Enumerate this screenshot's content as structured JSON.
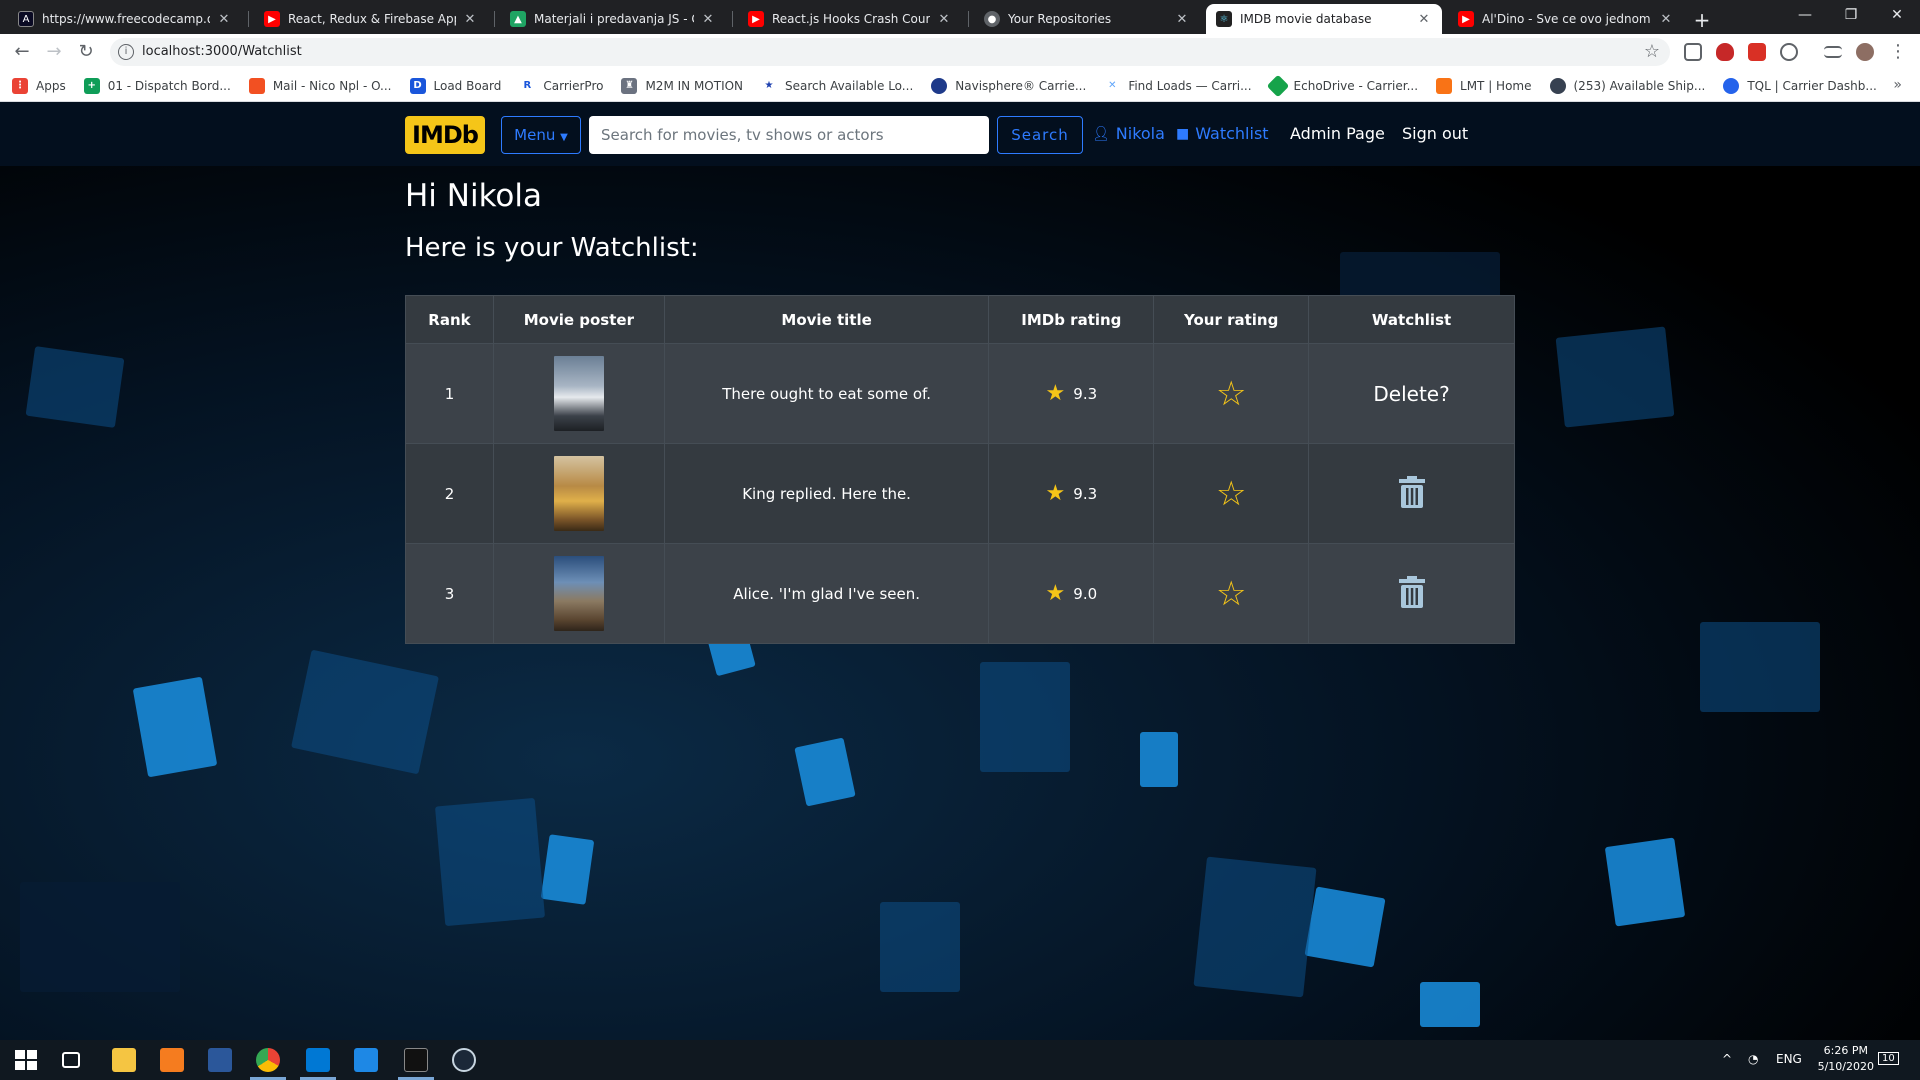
{
  "browser": {
    "tabs": [
      {
        "title": "https://www.freecodecamp.org/l",
        "favicon_color": "#0a0a23",
        "active": false
      },
      {
        "title": "React, Redux & Firebase App Tut",
        "favicon_color": "#ff0000",
        "active": false
      },
      {
        "title": "Materjali i predavanja JS - Googl",
        "favicon_color": "#1fa463",
        "active": false
      },
      {
        "title": "React.js Hooks Crash Course - Yo",
        "favicon_color": "#ff0000",
        "active": false
      },
      {
        "title": "Your Repositories",
        "favicon_color": "#5f6368",
        "active": false
      },
      {
        "title": "IMDB movie database",
        "favicon_color": "#61dafb",
        "active": true
      },
      {
        "title": "Al'Dino - Sve ce ovo jednom",
        "favicon_color": "#ff0000",
        "active": false
      }
    ],
    "url": "localhost:3000/Watchlist",
    "bookmarks": [
      {
        "label": "Apps",
        "color": "#ea4335"
      },
      {
        "label": "01 - Dispatch Bord...",
        "color": "#0f9d58"
      },
      {
        "label": "Mail - Nico Npl - O...",
        "color": "#f25022"
      },
      {
        "label": "Load Board",
        "color": "#1a56db"
      },
      {
        "label": "CarrierPro",
        "color": "#1a56db"
      },
      {
        "label": "M2M IN MOTION",
        "color": "#6b7280"
      },
      {
        "label": "Search Available Lo...",
        "color": "#1e40af"
      },
      {
        "label": "Navisphere® Carrie...",
        "color": "#1e3a8a"
      },
      {
        "label": "Find Loads — Carri...",
        "color": "#60a5fa"
      },
      {
        "label": "EchoDrive - Carrier...",
        "color": "#16a34a"
      },
      {
        "label": "LMT | Home",
        "color": "#f97316"
      },
      {
        "label": "(253) Available Ship...",
        "color": "#374151"
      },
      {
        "label": "TQL | Carrier Dashb...",
        "color": "#2563eb"
      }
    ]
  },
  "site": {
    "logo": "IMDb",
    "menu_label": "Menu",
    "search_placeholder": "Search for movies, tv shows or actors",
    "search_button": "Search",
    "user_link": "Nikola",
    "watchlist_link": "Watchlist",
    "admin_link": "Admin Page",
    "signout_link": "Sign out"
  },
  "page": {
    "greeting": "Hi Nikola",
    "subtitle": "Here is your Watchlist:"
  },
  "table": {
    "headers": [
      "Rank",
      "Movie poster",
      "Movie title",
      "IMDb rating",
      "Your rating",
      "Watchlist"
    ],
    "rows": [
      {
        "rank": "1",
        "title": "There ought to eat some of.",
        "rating": "9.3",
        "watchlist": "Delete?"
      },
      {
        "rank": "2",
        "title": "King replied. Here the.",
        "rating": "9.3",
        "watchlist": "trash-icon"
      },
      {
        "rank": "3",
        "title": "Alice. 'I'm glad I've seen.",
        "rating": "9.0",
        "watchlist": "trash-icon"
      }
    ]
  },
  "taskbar": {
    "lang": "ENG",
    "time": "6:26 PM",
    "date": "5/10/2020",
    "notifications": "10"
  },
  "colors": {
    "imdb_yellow": "#f5c518",
    "link_blue": "#2e7bff",
    "table_bg": "#343a40"
  }
}
